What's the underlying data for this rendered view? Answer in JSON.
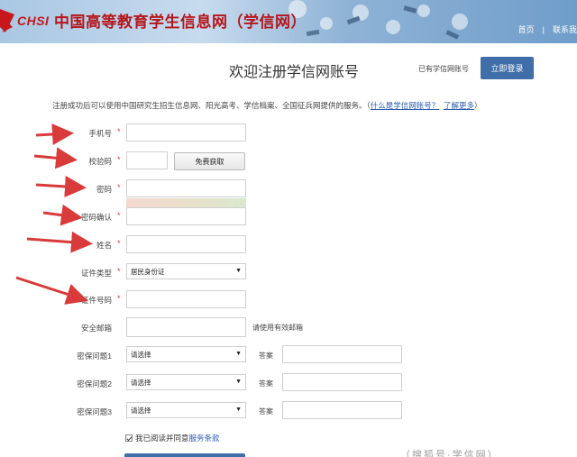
{
  "header": {
    "logo_text": "CHSI",
    "site_title": "中国高等教育学生信息网（学信网）",
    "nav": [
      {
        "label": "首页"
      },
      {
        "label": "联系我"
      }
    ]
  },
  "page": {
    "title": "欢迎注册学信网账号",
    "have_account": "已有学信网账号",
    "login_button": "立即登录"
  },
  "notice": {
    "text": "注册成功后可以使用中国研究生招生信息网、阳光高考、学信档案、全国征兵网提供的服务。",
    "open_paren": "（",
    "link1": "什么是学信网账号？",
    "link2": "了解更多",
    "close_paren": "）"
  },
  "form": {
    "required_mark": "*",
    "phone_label": "手机号",
    "code_label": "校验码",
    "code_button": "免费获取",
    "password_label": "密码",
    "password_confirm_label": "密码确认",
    "name_label": "姓名",
    "id_type_label": "证件类型",
    "id_type_value": "居民身份证",
    "id_number_label": "证件号码",
    "email_label": "安全邮箱",
    "email_hint": "请使用有效邮箱",
    "q1_label": "密保问题1",
    "q2_label": "密保问题2",
    "q3_label": "密保问题3",
    "q_placeholder": "请选择",
    "answer_label": "答案",
    "agree_text": "我已阅读并同意",
    "agree_link": "服务条款"
  },
  "watermark": "（搜狐号·学信网）",
  "colors": {
    "accent": "#3f6ea8",
    "required": "#e23a3a",
    "link": "#2a5db0",
    "annotation_arrow": "#d93a3a",
    "title_red": "#b5161b"
  }
}
